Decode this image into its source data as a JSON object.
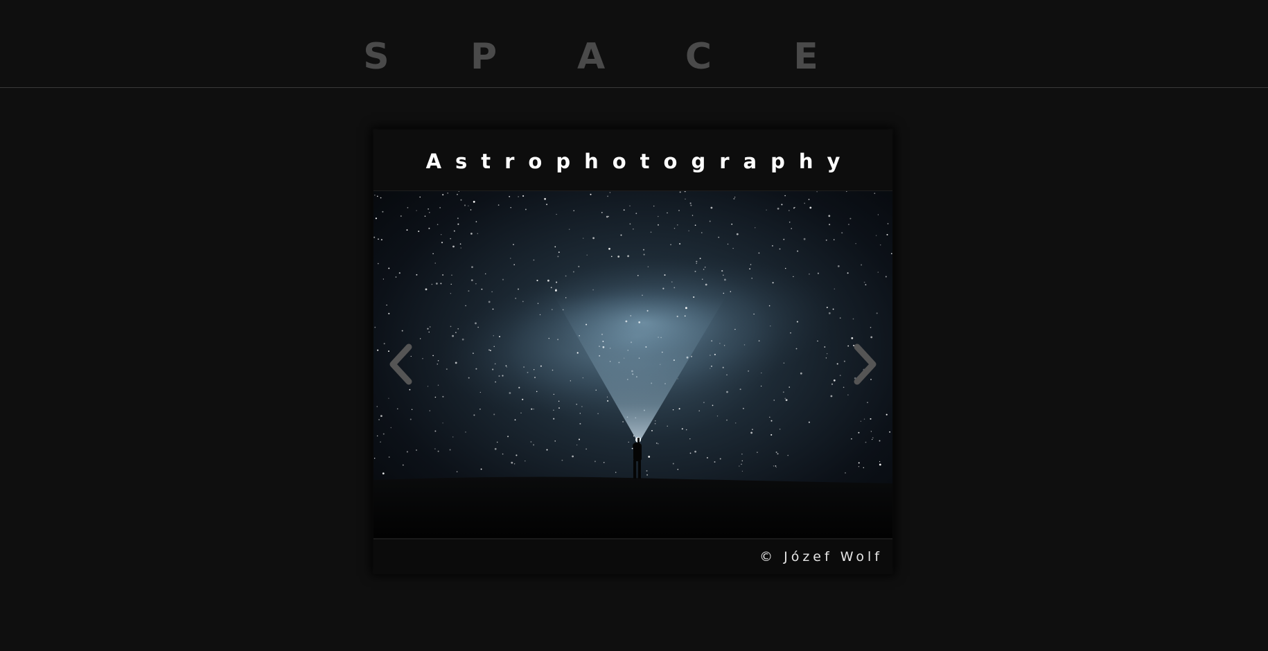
{
  "header": {
    "title_letters": [
      "S",
      "P",
      "A",
      "C",
      "E"
    ]
  },
  "card": {
    "title": "Astrophotography",
    "credit": "© Józef Wolf"
  },
  "icons": {
    "prev": "chevron-left-icon",
    "next": "chevron-right-icon"
  },
  "colors": {
    "background": "#0f0f0f",
    "header_text": "#4a4a4a",
    "card_text": "#ffffff"
  }
}
